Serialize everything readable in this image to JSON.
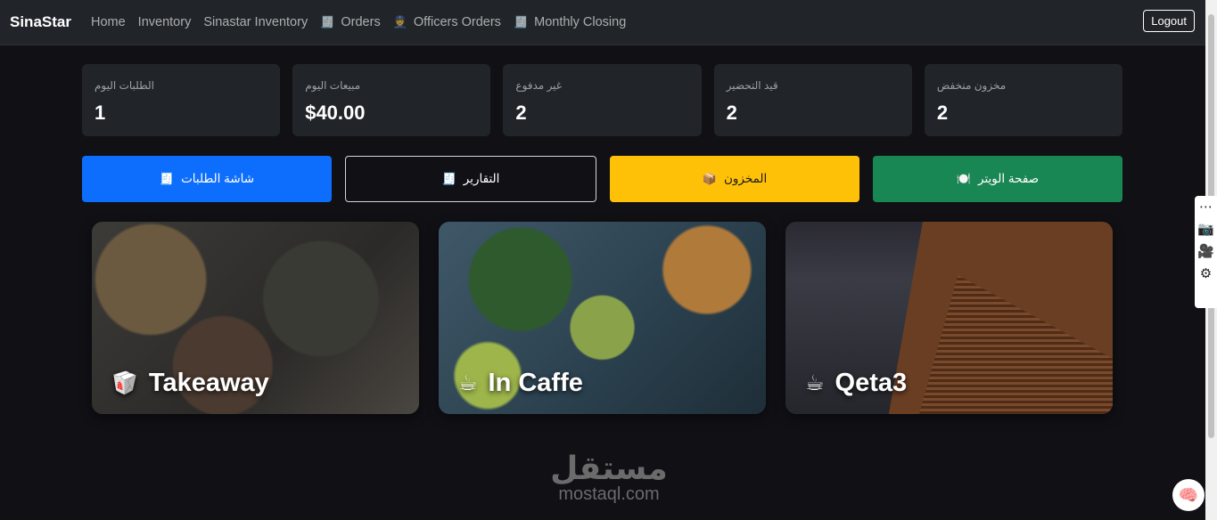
{
  "nav": {
    "brand": "SinaStar",
    "links": [
      {
        "label": "Home",
        "icon": ""
      },
      {
        "label": "Inventory",
        "icon": ""
      },
      {
        "label": "Sinastar Inventory",
        "icon": ""
      },
      {
        "label": "Orders",
        "icon": "🧾"
      },
      {
        "label": "Officers Orders",
        "icon": "👮"
      },
      {
        "label": "Monthly Closing",
        "icon": "🧾"
      }
    ],
    "logout": "Logout"
  },
  "stats": [
    {
      "label": "الطلبات اليوم",
      "value": "1"
    },
    {
      "label": "مبيعات اليوم",
      "value": "$40.00"
    },
    {
      "label": "غير مدفوع",
      "value": "2"
    },
    {
      "label": "قيد التحضير",
      "value": "2"
    },
    {
      "label": "مخزون منخفض",
      "value": "2"
    }
  ],
  "actions": [
    {
      "label": "شاشة الطلبات",
      "icon": "🧾",
      "color": "#0d6efd"
    },
    {
      "label": "التقارير",
      "icon": "🧾",
      "color": "#111015"
    },
    {
      "label": "المخزون",
      "icon": "📦",
      "color": "#ffc107"
    },
    {
      "label": "صفحة الويتر",
      "icon": "🍽️",
      "color": "#198754"
    }
  ],
  "cards": [
    {
      "title": "Takeaway",
      "icon": "🥡"
    },
    {
      "title": "In Caffe",
      "icon": "☕"
    },
    {
      "title": "Qeta3",
      "icon": "☕"
    }
  ],
  "watermark": {
    "arabic": "مستقل",
    "latin": "mostaql.com"
  }
}
